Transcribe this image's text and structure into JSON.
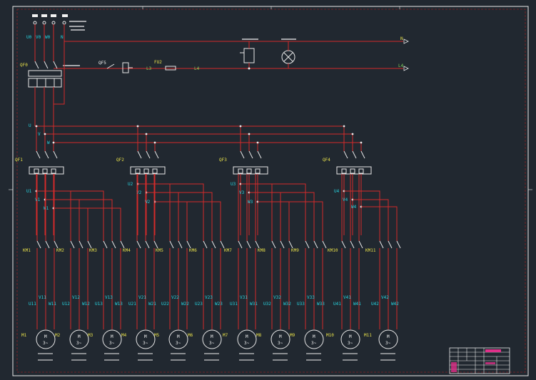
{
  "supply": {
    "phase_labels": [
      "U0",
      "V0",
      "W0",
      "N"
    ],
    "mark_lines": [
      "",
      ""
    ]
  },
  "top_circuit": {
    "main_breaker": "QF0",
    "breaker3": "QF5",
    "fuse": "FU2",
    "wire_l3": "L3",
    "wire_l4": "L4",
    "lamp_cn": "",
    "bus_n": "N",
    "bus_l4": "L4"
  },
  "bus": {
    "phases": [
      "U",
      "V",
      "W"
    ]
  },
  "breakers": [
    {
      "name": "QF1",
      "out": [
        "U1",
        "V1",
        "W1"
      ]
    },
    {
      "name": "QF2",
      "out": [
        "U2",
        "V2",
        "W2"
      ]
    },
    {
      "name": "QF3",
      "out": [
        "U3",
        "V3",
        "W3"
      ]
    },
    {
      "name": "QF4",
      "out": [
        "U4",
        "V4",
        "W4"
      ]
    }
  ],
  "contactors": [
    "KM1",
    "KM2",
    "KM3",
    "KM4",
    "KM5",
    "KM6",
    "KM7",
    "KM8",
    "KM9",
    "KM10",
    "KM11"
  ],
  "motors": [
    {
      "id": "M1",
      "u": "U11",
      "v": "V11",
      "w": "W11",
      "sym": "M",
      "phase": "3~"
    },
    {
      "id": "M2",
      "u": "U12",
      "v": "V12",
      "w": "W12",
      "sym": "M",
      "phase": "3~"
    },
    {
      "id": "M3",
      "u": "U13",
      "v": "V13",
      "w": "W13",
      "sym": "M",
      "phase": "3~"
    },
    {
      "id": "M4",
      "u": "U21",
      "v": "V21",
      "w": "W21",
      "sym": "M",
      "phase": "3~"
    },
    {
      "id": "M5",
      "u": "U22",
      "v": "V22",
      "w": "W22",
      "sym": "M",
      "phase": "3~"
    },
    {
      "id": "M6",
      "u": "U23",
      "v": "V23",
      "w": "W23",
      "sym": "M",
      "phase": "3~"
    },
    {
      "id": "M7",
      "u": "U31",
      "v": "V31",
      "w": "W31",
      "sym": "M",
      "phase": "3~"
    },
    {
      "id": "M8",
      "u": "U32",
      "v": "V32",
      "w": "W32",
      "sym": "M",
      "phase": "3~"
    },
    {
      "id": "M9",
      "u": "U33",
      "v": "V33",
      "w": "W33",
      "sym": "M",
      "phase": "3~"
    },
    {
      "id": "M10",
      "u": "U41",
      "v": "V41",
      "w": "W41",
      "sym": "M",
      "phase": "3~"
    },
    {
      "id": "M11",
      "u": "U42",
      "v": "V42",
      "w": "W42",
      "sym": "M",
      "phase": "3~"
    }
  ],
  "colors": {
    "background": "#212830",
    "wire": "#d42a2a",
    "frame": "#e9e9e9",
    "label_yellow": "#e8e14a",
    "label_cyan": "#27d3df",
    "label_green": "#7fd35a",
    "title_accent": "#e0308a"
  }
}
